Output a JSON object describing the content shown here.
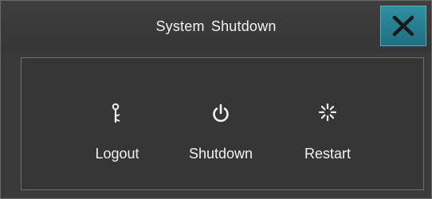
{
  "window": {
    "title": "System  Shutdown",
    "close_icon": "close-icon"
  },
  "actions": [
    {
      "label": "Logout",
      "icon": "key-icon"
    },
    {
      "label": "Shutdown",
      "icon": "power-icon"
    },
    {
      "label": "Restart",
      "icon": "restart-icon"
    }
  ],
  "colors": {
    "dialog_bg": "#3a3a3a",
    "close_button": "#2a8090",
    "text": "#f2f2f2"
  }
}
